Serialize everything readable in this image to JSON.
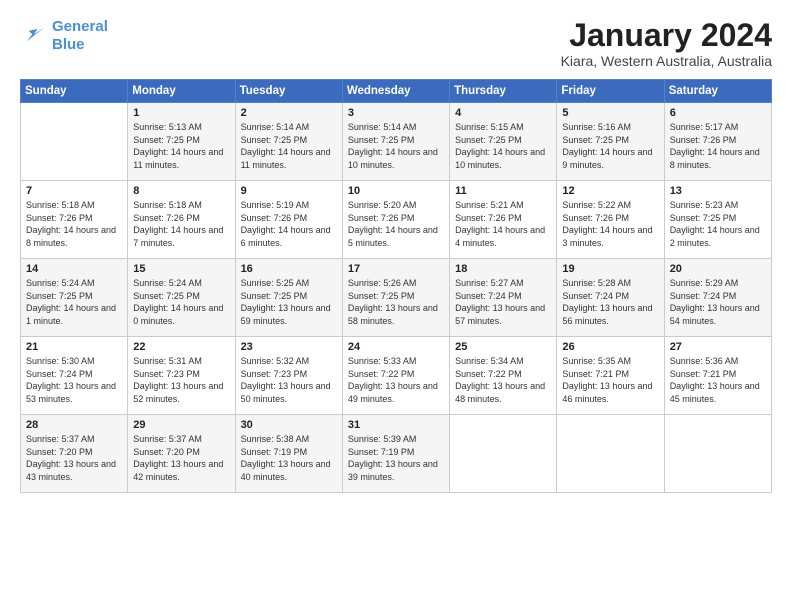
{
  "logo": {
    "line1": "General",
    "line2": "Blue"
  },
  "title": "January 2024",
  "subtitle": "Kiara, Western Australia, Australia",
  "weekdays": [
    "Sunday",
    "Monday",
    "Tuesday",
    "Wednesday",
    "Thursday",
    "Friday",
    "Saturday"
  ],
  "weeks": [
    [
      {
        "day": "",
        "sunrise": "",
        "sunset": "",
        "daylight": ""
      },
      {
        "day": "1",
        "sunrise": "5:13 AM",
        "sunset": "7:25 PM",
        "daylight": "14 hours and 11 minutes."
      },
      {
        "day": "2",
        "sunrise": "5:14 AM",
        "sunset": "7:25 PM",
        "daylight": "14 hours and 11 minutes."
      },
      {
        "day": "3",
        "sunrise": "5:14 AM",
        "sunset": "7:25 PM",
        "daylight": "14 hours and 10 minutes."
      },
      {
        "day": "4",
        "sunrise": "5:15 AM",
        "sunset": "7:25 PM",
        "daylight": "14 hours and 10 minutes."
      },
      {
        "day": "5",
        "sunrise": "5:16 AM",
        "sunset": "7:25 PM",
        "daylight": "14 hours and 9 minutes."
      },
      {
        "day": "6",
        "sunrise": "5:17 AM",
        "sunset": "7:26 PM",
        "daylight": "14 hours and 8 minutes."
      }
    ],
    [
      {
        "day": "7",
        "sunrise": "5:18 AM",
        "sunset": "7:26 PM",
        "daylight": "14 hours and 8 minutes."
      },
      {
        "day": "8",
        "sunrise": "5:18 AM",
        "sunset": "7:26 PM",
        "daylight": "14 hours and 7 minutes."
      },
      {
        "day": "9",
        "sunrise": "5:19 AM",
        "sunset": "7:26 PM",
        "daylight": "14 hours and 6 minutes."
      },
      {
        "day": "10",
        "sunrise": "5:20 AM",
        "sunset": "7:26 PM",
        "daylight": "14 hours and 5 minutes."
      },
      {
        "day": "11",
        "sunrise": "5:21 AM",
        "sunset": "7:26 PM",
        "daylight": "14 hours and 4 minutes."
      },
      {
        "day": "12",
        "sunrise": "5:22 AM",
        "sunset": "7:26 PM",
        "daylight": "14 hours and 3 minutes."
      },
      {
        "day": "13",
        "sunrise": "5:23 AM",
        "sunset": "7:25 PM",
        "daylight": "14 hours and 2 minutes."
      }
    ],
    [
      {
        "day": "14",
        "sunrise": "5:24 AM",
        "sunset": "7:25 PM",
        "daylight": "14 hours and 1 minute."
      },
      {
        "day": "15",
        "sunrise": "5:24 AM",
        "sunset": "7:25 PM",
        "daylight": "14 hours and 0 minutes."
      },
      {
        "day": "16",
        "sunrise": "5:25 AM",
        "sunset": "7:25 PM",
        "daylight": "13 hours and 59 minutes."
      },
      {
        "day": "17",
        "sunrise": "5:26 AM",
        "sunset": "7:25 PM",
        "daylight": "13 hours and 58 minutes."
      },
      {
        "day": "18",
        "sunrise": "5:27 AM",
        "sunset": "7:24 PM",
        "daylight": "13 hours and 57 minutes."
      },
      {
        "day": "19",
        "sunrise": "5:28 AM",
        "sunset": "7:24 PM",
        "daylight": "13 hours and 56 minutes."
      },
      {
        "day": "20",
        "sunrise": "5:29 AM",
        "sunset": "7:24 PM",
        "daylight": "13 hours and 54 minutes."
      }
    ],
    [
      {
        "day": "21",
        "sunrise": "5:30 AM",
        "sunset": "7:24 PM",
        "daylight": "13 hours and 53 minutes."
      },
      {
        "day": "22",
        "sunrise": "5:31 AM",
        "sunset": "7:23 PM",
        "daylight": "13 hours and 52 minutes."
      },
      {
        "day": "23",
        "sunrise": "5:32 AM",
        "sunset": "7:23 PM",
        "daylight": "13 hours and 50 minutes."
      },
      {
        "day": "24",
        "sunrise": "5:33 AM",
        "sunset": "7:22 PM",
        "daylight": "13 hours and 49 minutes."
      },
      {
        "day": "25",
        "sunrise": "5:34 AM",
        "sunset": "7:22 PM",
        "daylight": "13 hours and 48 minutes."
      },
      {
        "day": "26",
        "sunrise": "5:35 AM",
        "sunset": "7:21 PM",
        "daylight": "13 hours and 46 minutes."
      },
      {
        "day": "27",
        "sunrise": "5:36 AM",
        "sunset": "7:21 PM",
        "daylight": "13 hours and 45 minutes."
      }
    ],
    [
      {
        "day": "28",
        "sunrise": "5:37 AM",
        "sunset": "7:20 PM",
        "daylight": "13 hours and 43 minutes."
      },
      {
        "day": "29",
        "sunrise": "5:37 AM",
        "sunset": "7:20 PM",
        "daylight": "13 hours and 42 minutes."
      },
      {
        "day": "30",
        "sunrise": "5:38 AM",
        "sunset": "7:19 PM",
        "daylight": "13 hours and 40 minutes."
      },
      {
        "day": "31",
        "sunrise": "5:39 AM",
        "sunset": "7:19 PM",
        "daylight": "13 hours and 39 minutes."
      },
      {
        "day": "",
        "sunrise": "",
        "sunset": "",
        "daylight": ""
      },
      {
        "day": "",
        "sunrise": "",
        "sunset": "",
        "daylight": ""
      },
      {
        "day": "",
        "sunrise": "",
        "sunset": "",
        "daylight": ""
      }
    ]
  ]
}
